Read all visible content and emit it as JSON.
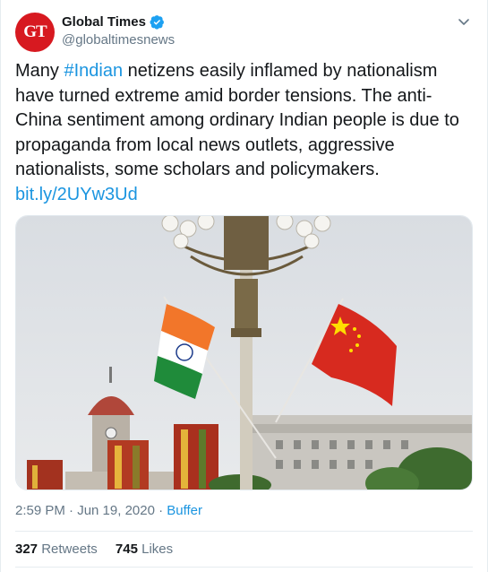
{
  "tweet": {
    "avatar_text": "GT",
    "display_name": "Global Times",
    "handle": "@globaltimesnews",
    "verified": true,
    "text_before": "Many ",
    "hashtag": "#Indian",
    "text_after": " netizens easily inflamed by nationalism have turned extreme amid border tensions. The anti-China sentiment among ordinary Indian people is due to propaganda from local news outlets, aggressive nationalists, some scholars and policymakers.",
    "link": "bit.ly/2UYw3Ud",
    "timestamp": "2:59 PM · Jun 19, 2020 · ",
    "source_app": "Buffer",
    "retweets_count": "327",
    "retweets_label": "Retweets",
    "likes_count": "745",
    "likes_label": "Likes"
  },
  "colors": {
    "link": "#1b95e0",
    "avatar_bg": "#d71920",
    "muted": "#657786"
  },
  "icons": {
    "verified": "verified-badge-icon",
    "menu": "chevron-down-icon"
  }
}
